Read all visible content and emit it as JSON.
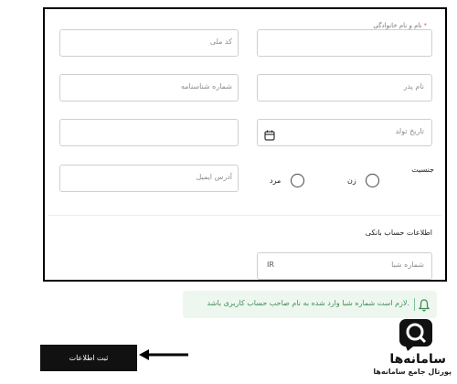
{
  "form": {
    "fullname_label": "نام و نام خانوادگی",
    "required_mark": "*",
    "national_code_placeholder": "کد ملی",
    "father_name_placeholder": "نام پدر",
    "id_number_placeholder": "شماره شناسنامه",
    "birth_date_placeholder": "تاریخ تولد",
    "gender_label": "جنسیت",
    "gender_female": "زن",
    "gender_male": "مرد",
    "email_placeholder": "آدرس ایمیل",
    "bank_section_title": "اطلاعات حساب بانکی",
    "sheba_placeholder": "شماره شبا",
    "sheba_prefix": "IR"
  },
  "notice": {
    "text": "لازم است شماره شبا وارد شده به نام صاحب حساب کاربری باشد.",
    "icon": "bell-icon"
  },
  "submit": {
    "label": "ثبت اطلاعات"
  },
  "logo": {
    "title": "سامانه‌ها",
    "subtitle": "پورتال جامع سامانه‌ها"
  },
  "colors": {
    "frame": "#000000",
    "notice_bg": "#eef7ef",
    "notice_text": "#3e8e57",
    "button_bg": "#111111"
  }
}
